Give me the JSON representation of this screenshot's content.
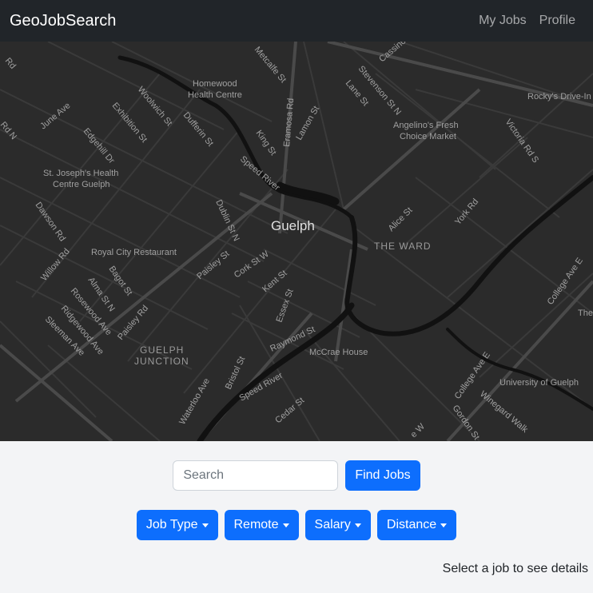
{
  "navbar": {
    "brand": "GeoJobSearch",
    "links": [
      {
        "label": "My Jobs"
      },
      {
        "label": "Profile"
      }
    ]
  },
  "map": {
    "city_label": "Guelph",
    "places": {
      "homewood_1": "Homewood",
      "homewood_2": "Health Centre",
      "angelinos_1": "Angelino's Fresh",
      "angelinos_2": "Choice Market",
      "stjosephs_1": "St. Joseph's Health",
      "stjosephs_2": "Centre Guelph",
      "royal_city": "Royal City Restaurant",
      "the_ward": "THE WARD",
      "guelph_junction_1": "GUELPH",
      "guelph_junction_2": "JUNCTION",
      "mccrae": "McCrae House",
      "university": "University of Guelph",
      "rockys": "Rocky's Drive-In",
      "the_partial": "The"
    },
    "streets": {
      "metcalfe": "Metcalfe St",
      "cassino": "Cassino",
      "stevenson": "Stevenson St N",
      "lane": "Lane St",
      "woolwich": "Woolwich St",
      "dufferin": "Dufferin St",
      "eramosa": "Eramosa Rd",
      "lamon": "Lamon St",
      "king": "King St",
      "victoria": "Victoria Rd S",
      "june": "June Ave",
      "exhibition": "Exhibition St",
      "edgehill": "Edgehill Dr",
      "speed_river_1": "Speed River",
      "dawson": "Dawson Rd",
      "dublin": "Dublin St N",
      "alice": "Alice St",
      "york": "York Rd",
      "willow": "Willow Rd",
      "paisley_st": "Paisley St",
      "cork": "Cork St W",
      "bagot": "Bagot St",
      "alma": "Alma St N",
      "kent": "Kent St",
      "rosewood": "Rosewood Ave",
      "ridgewood": "Ridgewood Ave",
      "paisley_rd": "Paisley Rd",
      "essex": "Essex St",
      "college_e": "College Ave E",
      "sleeman": "Sleeman Ave",
      "raymond": "Raymond St",
      "bristol": "Bristol St",
      "speed_river_2": "Speed River",
      "waterloo": "Waterloo Ave",
      "cedar": "Cedar St",
      "college_e2": "College Ave E",
      "winegard": "Winegard Walk",
      "gordon": "Gordon St",
      "rd_top": "Rd",
      "rd_n_left": "Rd N",
      "w_partial": "e W"
    }
  },
  "search": {
    "placeholder": "Search",
    "value": "",
    "button_label": "Find Jobs"
  },
  "filters": [
    {
      "label": "Job Type"
    },
    {
      "label": "Remote"
    },
    {
      "label": "Salary"
    },
    {
      "label": "Distance"
    }
  ],
  "details_hint": "Select a job to see details",
  "colors": {
    "navbar_bg": "#212529",
    "map_bg": "#2b2b2b",
    "primary": "#0d6efd",
    "page_bg": "#f3f4f6"
  }
}
